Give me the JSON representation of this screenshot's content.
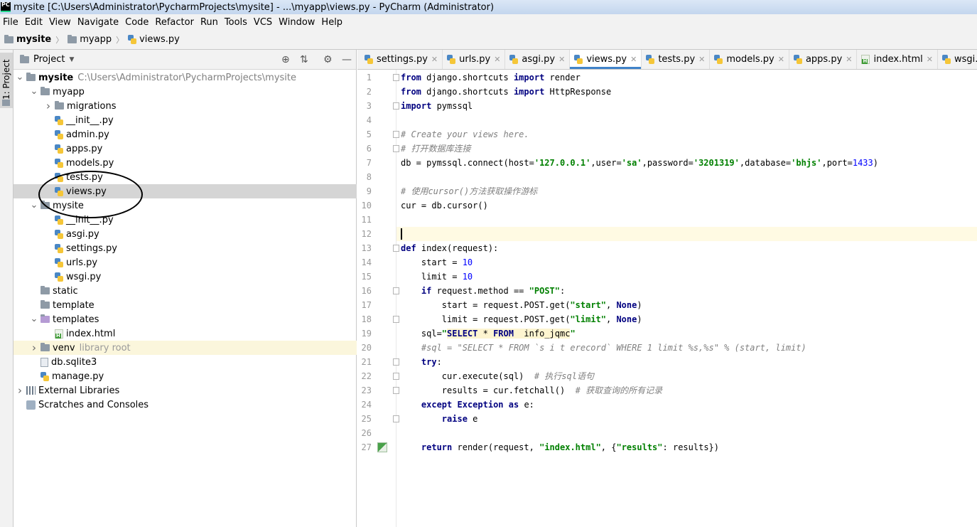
{
  "window": {
    "title": "mysite [C:\\Users\\Administrator\\PycharmProjects\\mysite] - ...\\myapp\\views.py - PyCharm (Administrator)",
    "logo_text": "PC"
  },
  "menu": [
    {
      "label": "File"
    },
    {
      "label": "Edit"
    },
    {
      "label": "View"
    },
    {
      "label": "Navigate"
    },
    {
      "label": "Code"
    },
    {
      "label": "Refactor"
    },
    {
      "label": "Run"
    },
    {
      "label": "Tools"
    },
    {
      "label": "VCS"
    },
    {
      "label": "Window"
    },
    {
      "label": "Help"
    }
  ],
  "breadcrumb": [
    "mysite",
    "myapp",
    "views.py"
  ],
  "left_stripe": {
    "tab_label": "1: Project"
  },
  "project_panel": {
    "title": "Project",
    "tree": [
      {
        "name": "mysite",
        "path": "C:\\Users\\Administrator\\PycharmProjects\\mysite",
        "type": "folder",
        "depth": 0,
        "expanded": true
      },
      {
        "name": "myapp",
        "type": "folder",
        "depth": 1,
        "expanded": true
      },
      {
        "name": "migrations",
        "type": "folder",
        "depth": 2,
        "expanded": false
      },
      {
        "name": "__init__.py",
        "type": "py",
        "depth": 2
      },
      {
        "name": "admin.py",
        "type": "py",
        "depth": 2
      },
      {
        "name": "apps.py",
        "type": "py",
        "depth": 2
      },
      {
        "name": "models.py",
        "type": "py",
        "depth": 2
      },
      {
        "name": "tests.py",
        "type": "py",
        "depth": 2
      },
      {
        "name": "views.py",
        "type": "py",
        "depth": 2,
        "selected": true
      },
      {
        "name": "mysite",
        "type": "folder",
        "depth": 1,
        "expanded": true
      },
      {
        "name": "__init__.py",
        "type": "py",
        "depth": 2
      },
      {
        "name": "asgi.py",
        "type": "py",
        "depth": 2
      },
      {
        "name": "settings.py",
        "type": "py",
        "depth": 2
      },
      {
        "name": "urls.py",
        "type": "py",
        "depth": 2
      },
      {
        "name": "wsgi.py",
        "type": "py",
        "depth": 2
      },
      {
        "name": "static",
        "type": "folder",
        "depth": 1
      },
      {
        "name": "template",
        "type": "folder",
        "depth": 1
      },
      {
        "name": "templates",
        "type": "folder-purple",
        "depth": 1,
        "expanded": true
      },
      {
        "name": "index.html",
        "type": "html",
        "depth": 2
      },
      {
        "name": "venv",
        "lib": "library root",
        "type": "folder",
        "depth": 1,
        "expanded": false,
        "excluded": true
      },
      {
        "name": "db.sqlite3",
        "type": "db",
        "depth": 1
      },
      {
        "name": "manage.py",
        "type": "py",
        "depth": 1
      },
      {
        "name": "External Libraries",
        "type": "libs",
        "depth": 0,
        "expanded": false
      },
      {
        "name": "Scratches and Consoles",
        "type": "scratch",
        "depth": 0
      }
    ]
  },
  "tabs": [
    {
      "label": "settings.py",
      "type": "py"
    },
    {
      "label": "urls.py",
      "type": "py"
    },
    {
      "label": "asgi.py",
      "type": "py"
    },
    {
      "label": "views.py",
      "type": "py",
      "active": true
    },
    {
      "label": "tests.py",
      "type": "py"
    },
    {
      "label": "models.py",
      "type": "py"
    },
    {
      "label": "apps.py",
      "type": "py"
    },
    {
      "label": "index.html",
      "type": "html"
    },
    {
      "label": "wsgi.py",
      "type": "py"
    }
  ],
  "editor": {
    "current_line": 12,
    "lines": [
      [
        [
          "kw",
          "from"
        ],
        [
          "id",
          " django.shortcuts "
        ],
        [
          "kw",
          "import"
        ],
        [
          "id",
          " render"
        ]
      ],
      [
        [
          "kw",
          "from"
        ],
        [
          "id",
          " django.shortcuts "
        ],
        [
          "kw",
          "import"
        ],
        [
          "id",
          " HttpResponse"
        ]
      ],
      [
        [
          "kw",
          "import"
        ],
        [
          "id",
          " pymssql"
        ]
      ],
      [],
      [
        [
          "cm",
          "# Create your views here."
        ]
      ],
      [
        [
          "cm",
          "# 打开数据库连接"
        ]
      ],
      [
        [
          "id",
          "db = pymssql.connect(host="
        ],
        [
          "str",
          "'127.0.0.1'"
        ],
        [
          "id",
          ",user="
        ],
        [
          "str",
          "'sa'"
        ],
        [
          "id",
          ",password="
        ],
        [
          "str",
          "'3201319'"
        ],
        [
          "id",
          ",database="
        ],
        [
          "str",
          "'bhjs'"
        ],
        [
          "id",
          ",port="
        ],
        [
          "num",
          "1433"
        ],
        [
          "id",
          ")"
        ]
      ],
      [],
      [
        [
          "cm",
          "# 使用cursor()方法获取操作游标"
        ]
      ],
      [
        [
          "id",
          "cur = db.cursor()"
        ]
      ],
      [],
      [],
      [
        [
          "kw",
          "def"
        ],
        [
          "id",
          " index(request):"
        ]
      ],
      [
        [
          "id",
          "    start = "
        ],
        [
          "num",
          "10"
        ]
      ],
      [
        [
          "id",
          "    limit = "
        ],
        [
          "num",
          "10"
        ]
      ],
      [
        [
          "id",
          "    "
        ],
        [
          "kw",
          "if"
        ],
        [
          "id",
          " request.method == "
        ],
        [
          "str",
          "\"POST\""
        ],
        [
          "id",
          ":"
        ]
      ],
      [
        [
          "id",
          "        start = request.POST.get("
        ],
        [
          "str",
          "\"start\""
        ],
        [
          "id",
          ", "
        ],
        [
          "kw",
          "None"
        ],
        [
          "id",
          ")"
        ]
      ],
      [
        [
          "id",
          "        limit = request.POST.get("
        ],
        [
          "str",
          "\"limit\""
        ],
        [
          "id",
          ", "
        ],
        [
          "kw",
          "None"
        ],
        [
          "id",
          ")"
        ]
      ],
      [
        [
          "id",
          "    sql="
        ],
        [
          "str",
          "\""
        ],
        [
          "sqlkw",
          "SELECT"
        ],
        [
          "sqlplain",
          " * "
        ],
        [
          "sqlkw",
          "FROM"
        ],
        [
          "sqlplain",
          "  info_jqmc"
        ],
        [
          "str",
          "\""
        ]
      ],
      [
        [
          "cm",
          "    #sql = \"SELECT * FROM `s i t erecord` WHERE 1 limit %s,%s\" % (start, limit)"
        ]
      ],
      [
        [
          "id",
          "    "
        ],
        [
          "kw",
          "try"
        ],
        [
          "id",
          ":"
        ]
      ],
      [
        [
          "id",
          "        cur.execute(sql)  "
        ],
        [
          "cm",
          "# 执行sql语句"
        ]
      ],
      [
        [
          "id",
          "        results = cur.fetchall()  "
        ],
        [
          "cm",
          "# 获取查询的所有记录"
        ]
      ],
      [
        [
          "id",
          "    "
        ],
        [
          "kw",
          "except"
        ],
        [
          "id",
          " "
        ],
        [
          "kw",
          "Exception"
        ],
        [
          "id",
          " "
        ],
        [
          "kw",
          "as"
        ],
        [
          "id",
          " e:"
        ]
      ],
      [
        [
          "id",
          "        "
        ],
        [
          "kw",
          "raise"
        ],
        [
          "id",
          " e"
        ]
      ],
      [],
      [
        [
          "id",
          "    "
        ],
        [
          "kw",
          "return"
        ],
        [
          "id",
          " render(request, "
        ],
        [
          "str",
          "\"index.html\""
        ],
        [
          "id",
          ", {"
        ],
        [
          "str",
          "\"results\""
        ],
        [
          "id",
          ": results})"
        ]
      ]
    ]
  }
}
